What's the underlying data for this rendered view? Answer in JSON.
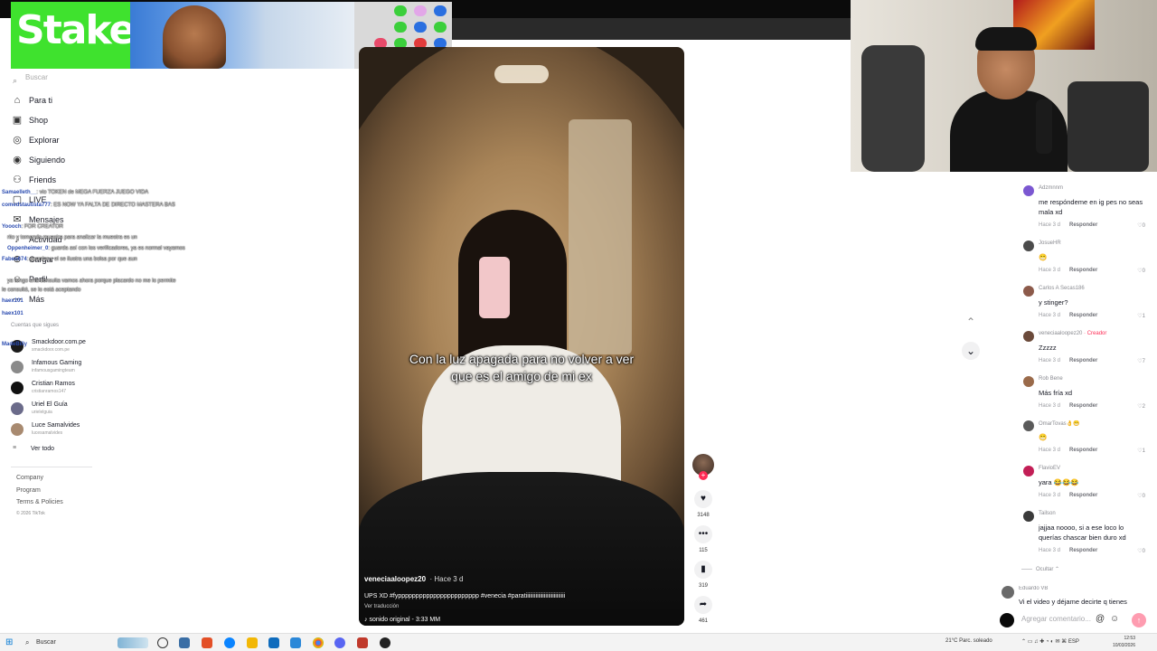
{
  "search": {
    "placeholder": "Buscar"
  },
  "sidebar": {
    "items": [
      {
        "label": "Para ti",
        "icon": "home-icon"
      },
      {
        "label": "Shop",
        "icon": "shop-icon"
      },
      {
        "label": "Explorar",
        "icon": "compass-icon"
      },
      {
        "label": "Siguiendo",
        "icon": "following-icon"
      },
      {
        "label": "Friends",
        "icon": "friends-icon"
      },
      {
        "label": "LIVE",
        "icon": "live-icon"
      },
      {
        "label": "Mensajes",
        "icon": "message-icon"
      },
      {
        "label": "Actividad",
        "icon": "bell-icon"
      },
      {
        "label": "Cargar",
        "icon": "upload-icon"
      },
      {
        "label": "Perfil",
        "icon": "profile-icon"
      },
      {
        "label": "Más",
        "icon": "more-icon"
      }
    ],
    "following_header": "Cuentas que sigues",
    "following": [
      {
        "name": "Smackdoor.com.pe",
        "handle": "smackdoor.com.pe"
      },
      {
        "name": "Infamous Gaming",
        "handle": "infamousgamingteam"
      },
      {
        "name": "Cristian Ramos",
        "handle": "cristianramos147"
      },
      {
        "name": "Uriel El Guía",
        "handle": "urielelguia"
      },
      {
        "name": "Luce Samalvides",
        "handle": "lucesamalvides"
      }
    ],
    "see_all": "Ver todo",
    "footer": [
      "Company",
      "Program",
      "Terms & Policies",
      "© 2026 TikTok"
    ]
  },
  "overlay_chat": [
    {
      "user": "Samaelleth__",
      "msg": ": vio TOKEN de MEGA FUERZA JUEGO VIDA"
    },
    {
      "user": "comedstautista777",
      "msg": ": ES NOW YA FALTA DE DIRECTO MASTERA BAS"
    },
    {
      "user": "Yoooch",
      "msg": ": FOR CREATOR"
    },
    {
      "user": "",
      "msg": "rito y tomando muestra para analizar la muestra es un"
    },
    {
      "user": "Oppenheimer_0",
      "msg": ": guarda así con los verificadores, ya es normal vayamos"
    },
    {
      "user": "Fabeo674",
      "msg": ": guardar y el se ilustra una bolsa por que aun"
    },
    {
      "user": "",
      "msg": "ya tengo una consulta vamos ahora porque placardo no me lo permite"
    },
    {
      "user": "",
      "msg": "le consultó, se lo está aceptando"
    },
    {
      "user": "haex101",
      "msg": ""
    },
    {
      "user": "haex101",
      "msg": ""
    },
    {
      "user": "MadeBilly",
      "msg": ""
    }
  ],
  "video": {
    "caption_line1": "Con la luz apagada para no volver a ver",
    "caption_line2": "que es el amigo de mi ex",
    "author": "veneciaaloopez20",
    "age": "· Hace 3 d",
    "description": "UPS XD #fyppppppppppppppppppppppp #venecia #paratiiiiiiiiiiiiiiiiiiiiiiiiiiii",
    "translate": "Ver traducción",
    "sound": "sonido original - 3:33 MM"
  },
  "actions": {
    "likes": "3148",
    "comments": "115",
    "saves": "319",
    "shares": "461"
  },
  "comments": [
    {
      "author": "Adzmnnm",
      "text": "me respóndeme en ig pes no seas mala xd",
      "age": "Hace 3 d",
      "reply": "Responder",
      "likes": "0",
      "avatar": "#7b57d1"
    },
    {
      "author": "JosueHR",
      "text": "😁",
      "age": "Hace 3 d",
      "reply": "Responder",
      "likes": "0",
      "avatar": "#4b4b4b"
    },
    {
      "author": "Carlos A Secas186",
      "text": "y stinger?",
      "age": "Hace 3 d",
      "reply": "Responder",
      "likes": "1",
      "avatar": "#8c5a4a"
    },
    {
      "author": "veneciaaloopez20",
      "creator": "· Creador",
      "text": "Zzzzz",
      "age": "Hace 3 d",
      "reply": "Responder",
      "likes": "7",
      "avatar": "#6b4a3a"
    },
    {
      "author": "Rob Bene",
      "text": "Más fría xd",
      "age": "Hace 3 d",
      "reply": "Responder",
      "likes": "2",
      "avatar": "#9a6a4a"
    },
    {
      "author": "OmarTovas👌😁",
      "text": "😁",
      "age": "Hace 3 d",
      "reply": "Responder",
      "likes": "1",
      "avatar": "#5a5a5a"
    },
    {
      "author": "FlavioEV",
      "text": "yara 😂😂😂",
      "age": "Hace 3 d",
      "reply": "Responder",
      "likes": "0",
      "avatar": "#c21e56"
    },
    {
      "author": "Tailson",
      "text": "jajjaa noooo, si a ese loco lo querías chascar bien duro xd",
      "age": "Hace 3 d",
      "reply": "Responder",
      "likes": "0",
      "avatar": "#3a3a3a"
    }
  ],
  "hide_label": "Ocultar ⌃",
  "last_comment": {
    "author": "Eduardo VB",
    "text": "Vi el video y déjame decirte q tienes"
  },
  "add_comment": {
    "placeholder": "Agregar comentario..."
  },
  "taskbar": {
    "search": "Buscar",
    "weather": "21°C  Parc. soleado",
    "lang": "ESP",
    "time": "12:53",
    "date": "10/03/2026"
  },
  "colors": {
    "accent": "#fe2c55",
    "stake_green": "#3fe22e"
  }
}
